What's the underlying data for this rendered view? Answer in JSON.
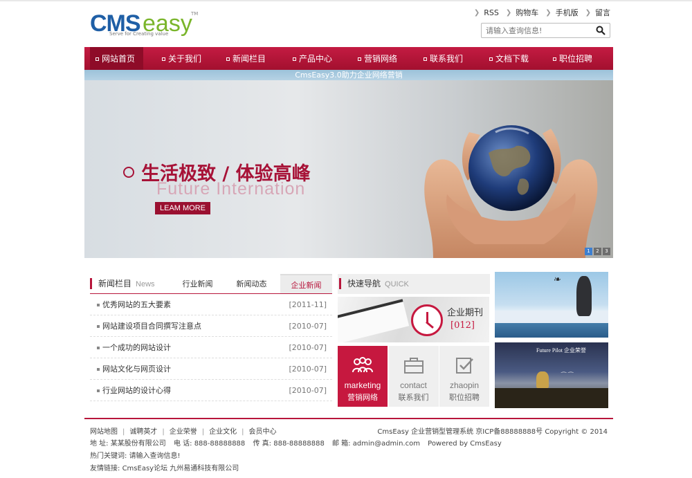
{
  "logo": {
    "part1": "CMS",
    "part2": "easy",
    "tm": "TM",
    "tagline": "Serve for Creating value"
  },
  "toplinks": [
    "RSS",
    "购物车",
    "手机版",
    "留言"
  ],
  "search": {
    "placeholder": "请输入查询信息!",
    "icon": "search-icon"
  },
  "nav": [
    "网站首页",
    "关于我们",
    "新闻栏目",
    "产品中心",
    "营销网络",
    "联系我们",
    "文档下载",
    "职位招聘"
  ],
  "banner": {
    "strip_text": "CmsEasy3.0助力企业网络营销",
    "slogan": "生活极致 / 体验高峰",
    "subtitle": "Future Internation",
    "button": "LEAM MORE",
    "dots": [
      "1",
      "2",
      "3"
    ]
  },
  "news": {
    "title": "新闻栏目",
    "title_en": "News",
    "tabs": [
      "行业新闻",
      "新闻动态",
      "企业新闻"
    ],
    "active_tab": 2,
    "items": [
      {
        "title": "优秀网站的五大要素",
        "date": "[2011-11]"
      },
      {
        "title": "网站建设项目合同撰写注意点",
        "date": "[2010-07]"
      },
      {
        "title": "一个成功的网站设计",
        "date": "[2010-07]"
      },
      {
        "title": "网站文化与网页设计",
        "date": "[2010-07]"
      },
      {
        "title": "行业网站的设计心得",
        "date": "[2010-07]"
      }
    ]
  },
  "quick": {
    "title": "快速导航",
    "title_en": "QUICK",
    "banner_title": "企业期刊",
    "banner_number": "[012]",
    "tiles": [
      {
        "en": "marketing",
        "zh": "营销网络",
        "icon": "people-icon"
      },
      {
        "en": "contact",
        "zh": "联系我们",
        "icon": "briefcase-icon"
      },
      {
        "en": "zhaopin",
        "zh": "职位招聘",
        "icon": "checkmark-icon"
      }
    ]
  },
  "side_images": {
    "img2_text": "Future Pilot 企业荣誉"
  },
  "footer": {
    "links": [
      "网站地图",
      "诚聘英才",
      "企业荣誉",
      "企业文化",
      "会员中心"
    ],
    "right": "CmsEasy 企业营销型管理系统  京ICP备88888888号  Copyright © 2014",
    "address_label": "地 址:",
    "address": "某某股份有限公司",
    "phone_label": "电 话:",
    "phone": "888-88888888",
    "fax_label": "传 真:",
    "fax": "888-88888888",
    "email_label": "邮 箱:",
    "email": "admin@admin.com",
    "powered": "Powered by CmsEasy",
    "hot_label": "热门关键词:",
    "hot": "请输入查询信息!",
    "friend_label": "友情链接:",
    "friend_links": [
      "CmsEasy论坛",
      "九州易通科技有限公司"
    ]
  }
}
